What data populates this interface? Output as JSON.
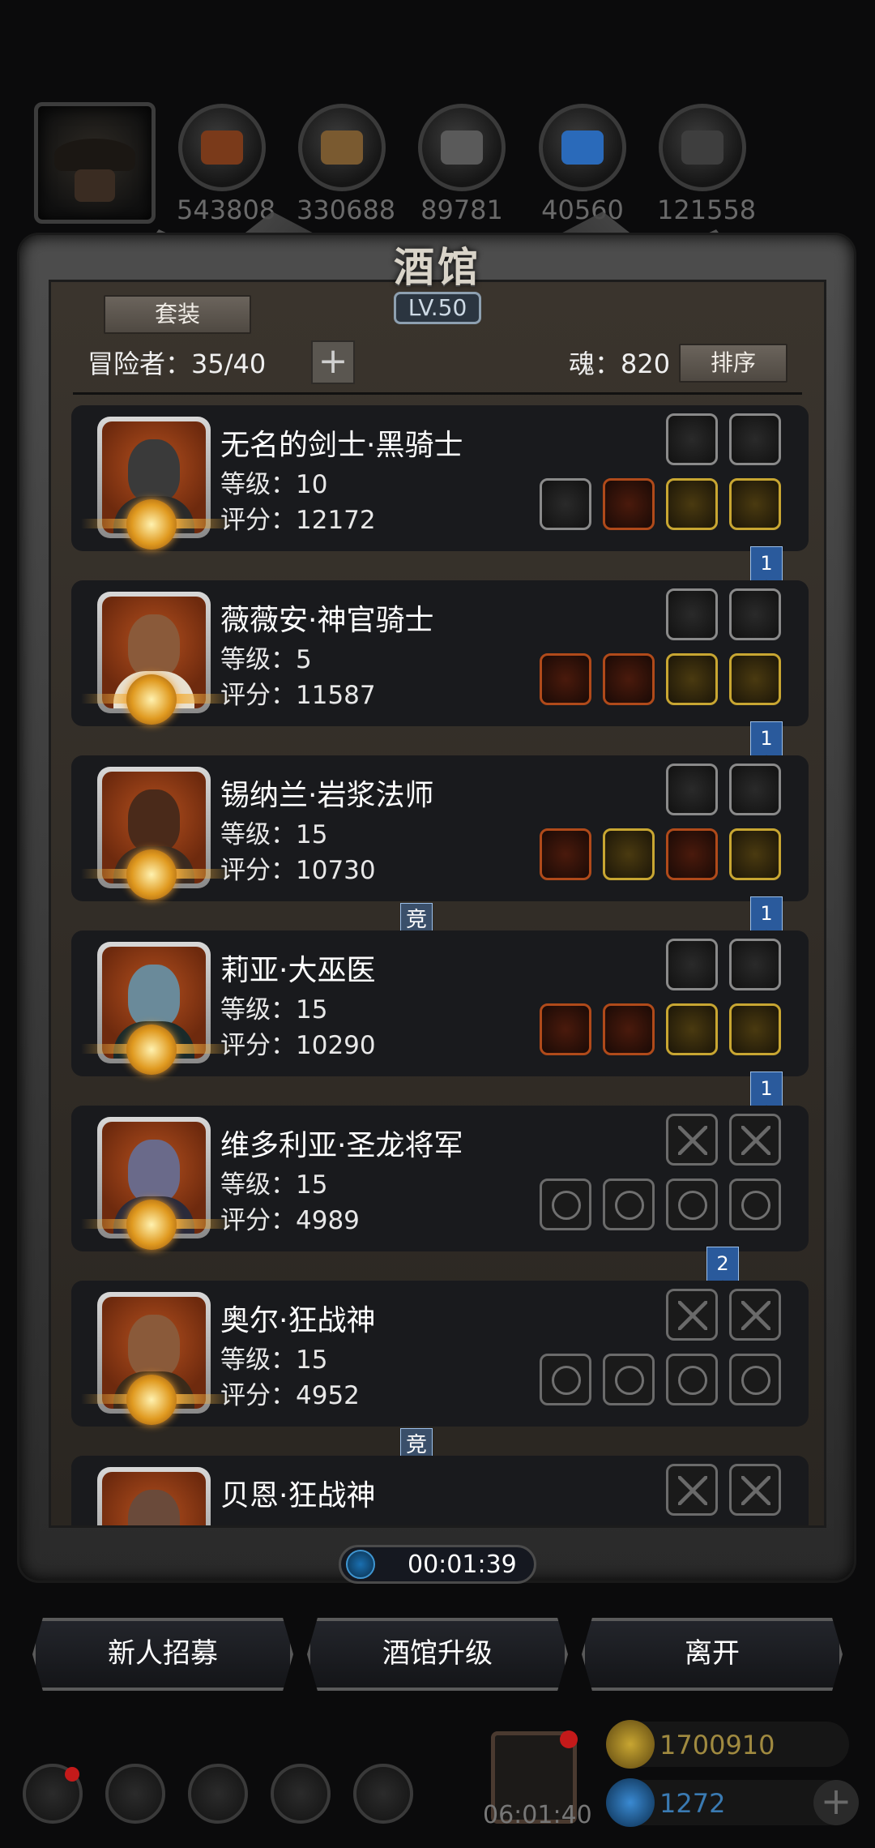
{
  "top_bar": {
    "resources": [
      {
        "icon": "leather-icon",
        "value": "543808",
        "color": "#7a3a1a"
      },
      {
        "icon": "wood-icon",
        "value": "330688",
        "color": "#7a5a30"
      },
      {
        "icon": "iron-icon",
        "value": "89781",
        "color": "#5a5a5a"
      },
      {
        "icon": "crystal-icon",
        "value": "40560",
        "color": "#2a6aba"
      },
      {
        "icon": "ingot-icon",
        "value": "121558",
        "color": "#3e3e3e"
      }
    ]
  },
  "panel": {
    "title": "酒馆",
    "level": "LV.50",
    "outfit_button": "套装",
    "adventurers_label": "冒险者：35/40",
    "add_button": "+",
    "soul_label": "魂：820",
    "sort_button": "排序"
  },
  "heroes": [
    {
      "name": "无名的剑士·黑骑士",
      "level": "等级：10",
      "score": "评分：12172",
      "head_color": "#3a3a3a",
      "body_color": "#2a2a2a",
      "top_slots": [
        "gray",
        "gray"
      ],
      "bottom_slots": [
        "gray",
        "orange",
        "yellow",
        "yellow"
      ],
      "ribbon_right": "1",
      "ribbon_mid": ""
    },
    {
      "name": "薇薇安·神官骑士",
      "level": "等级：5",
      "score": "评分：11587",
      "head_color": "#8a5a3a",
      "body_color": "#e8e0d0",
      "top_slots": [
        "gray",
        "gray"
      ],
      "bottom_slots": [
        "orange",
        "orange",
        "yellow",
        "yellow"
      ],
      "ribbon_right": "1",
      "ribbon_mid": ""
    },
    {
      "name": "锡纳兰·岩浆法师",
      "level": "等级：15",
      "score": "评分：10730",
      "head_color": "#4a2a1a",
      "body_color": "#3a2a20",
      "top_slots": [
        "gray",
        "gray"
      ],
      "bottom_slots": [
        "orange",
        "yellow",
        "orange",
        "yellow"
      ],
      "ribbon_right": "1",
      "ribbon_mid": "竞"
    },
    {
      "name": "莉亚·大巫医",
      "level": "等级：15",
      "score": "评分：10290",
      "head_color": "#6a8a9a",
      "body_color": "#1a2a2a",
      "top_slots": [
        "gray",
        "gray"
      ],
      "bottom_slots": [
        "orange",
        "orange",
        "yellow",
        "yellow"
      ],
      "ribbon_right": "1",
      "ribbon_mid": ""
    },
    {
      "name": "维多利亚·圣龙将军",
      "level": "等级：15",
      "score": "评分：4989",
      "head_color": "#6a6a8a",
      "body_color": "#2a2a3a",
      "top_slots": [
        "empty-hour",
        "empty-hour"
      ],
      "bottom_slots": [
        "empty",
        "empty",
        "empty",
        "empty"
      ],
      "ribbon_right": "2",
      "ribbon_mid": ""
    },
    {
      "name": "奥尔·狂战神",
      "level": "等级：15",
      "score": "评分：4952",
      "head_color": "#8a5a3a",
      "body_color": "#3a2a1a",
      "top_slots": [
        "empty-hour",
        "empty-hour"
      ],
      "bottom_slots": [
        "empty",
        "empty",
        "empty",
        "empty"
      ],
      "ribbon_right": "",
      "ribbon_mid": "竞"
    },
    {
      "name": "贝恩·狂战神",
      "level": "",
      "score": "",
      "head_color": "#6a4a3a",
      "body_color": "#3a2a1a",
      "top_slots": [
        "empty-hour",
        "empty-hour"
      ],
      "bottom_slots": [],
      "ribbon_right": "",
      "ribbon_mid": ""
    }
  ],
  "timer": {
    "icon": "clock-icon",
    "value": "00:01:39"
  },
  "actions": [
    {
      "label": "新人招募"
    },
    {
      "label": "酒馆升级"
    },
    {
      "label": "离开"
    }
  ],
  "footer": {
    "icons": [
      "settings-icon",
      "achievement-icon",
      "hero-icon",
      "mail-icon",
      "map-icon"
    ],
    "gift_timer": "06:01:40",
    "gold": {
      "icon": "gold-coin-icon",
      "value": "1700910",
      "color": "#c8a632"
    },
    "gems": {
      "icon": "blue-gem-icon",
      "value": "1272",
      "color": "#3a8ad2"
    },
    "add": "+"
  }
}
